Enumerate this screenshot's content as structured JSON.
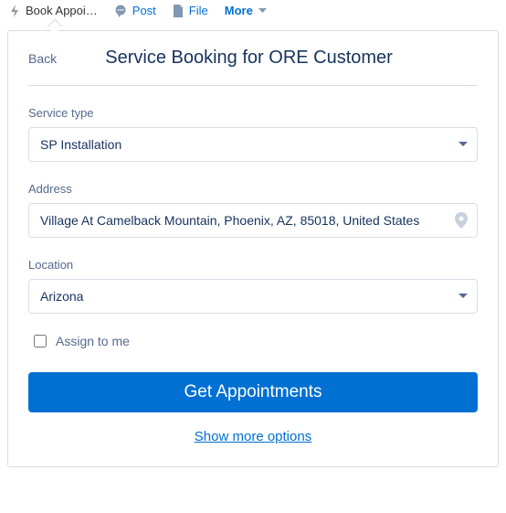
{
  "tabs": {
    "book": "Book Appoi…",
    "post": "Post",
    "file": "File",
    "more": "More"
  },
  "header": {
    "back": "Back",
    "title": "Service Booking for ORE Customer"
  },
  "fields": {
    "service_type": {
      "label": "Service type",
      "value": "SP Installation"
    },
    "address": {
      "label": "Address",
      "value": "Village At Camelback Mountain, Phoenix, AZ, 85018, United States"
    },
    "location": {
      "label": "Location",
      "value": "Arizona"
    },
    "assign": {
      "label": "Assign to me"
    }
  },
  "actions": {
    "get_appointments": "Get Appointments",
    "show_more": "Show more options"
  }
}
